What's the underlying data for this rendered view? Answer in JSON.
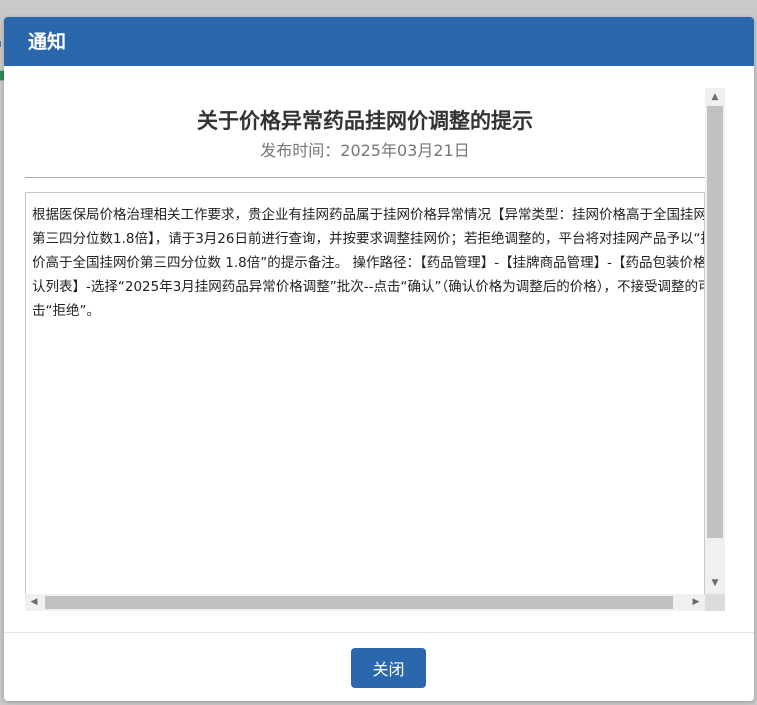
{
  "dialog": {
    "title": "通知",
    "notice": {
      "heading": "关于价格异常药品挂网价调整的提示",
      "publish_date": "发布时间：2025年03月21日",
      "content": "根据医保局价格治理相关工作要求，贵企业有挂网药品属于挂网价格异常情况【异常类型：挂网价格高于全国挂网价第三四分位数1.8倍】，请于3月26日前进行查询，并按要求调整挂网价；若拒绝调整的，平台将对挂网产品予以“挂网价高于全国挂网价第三四分位数 1.8倍”的提示备注。 操作路径：【药品管理】-【挂牌商品管理】-【药品包装价格确认列表】-选择“2025年3月挂网药品异常价格调整”批次--点击“确认”（确认价格为调整后的价格），不接受调整的可点击“拒绝”。"
    },
    "close_label": "关闭"
  },
  "icons": {
    "scroll_up": "▲",
    "scroll_down": "▼",
    "scroll_left": "◀",
    "scroll_right": "▶"
  },
  "colors": {
    "header": "#2b67ad",
    "button": "#2b67ad",
    "backdrop": "#c9c9c9"
  }
}
